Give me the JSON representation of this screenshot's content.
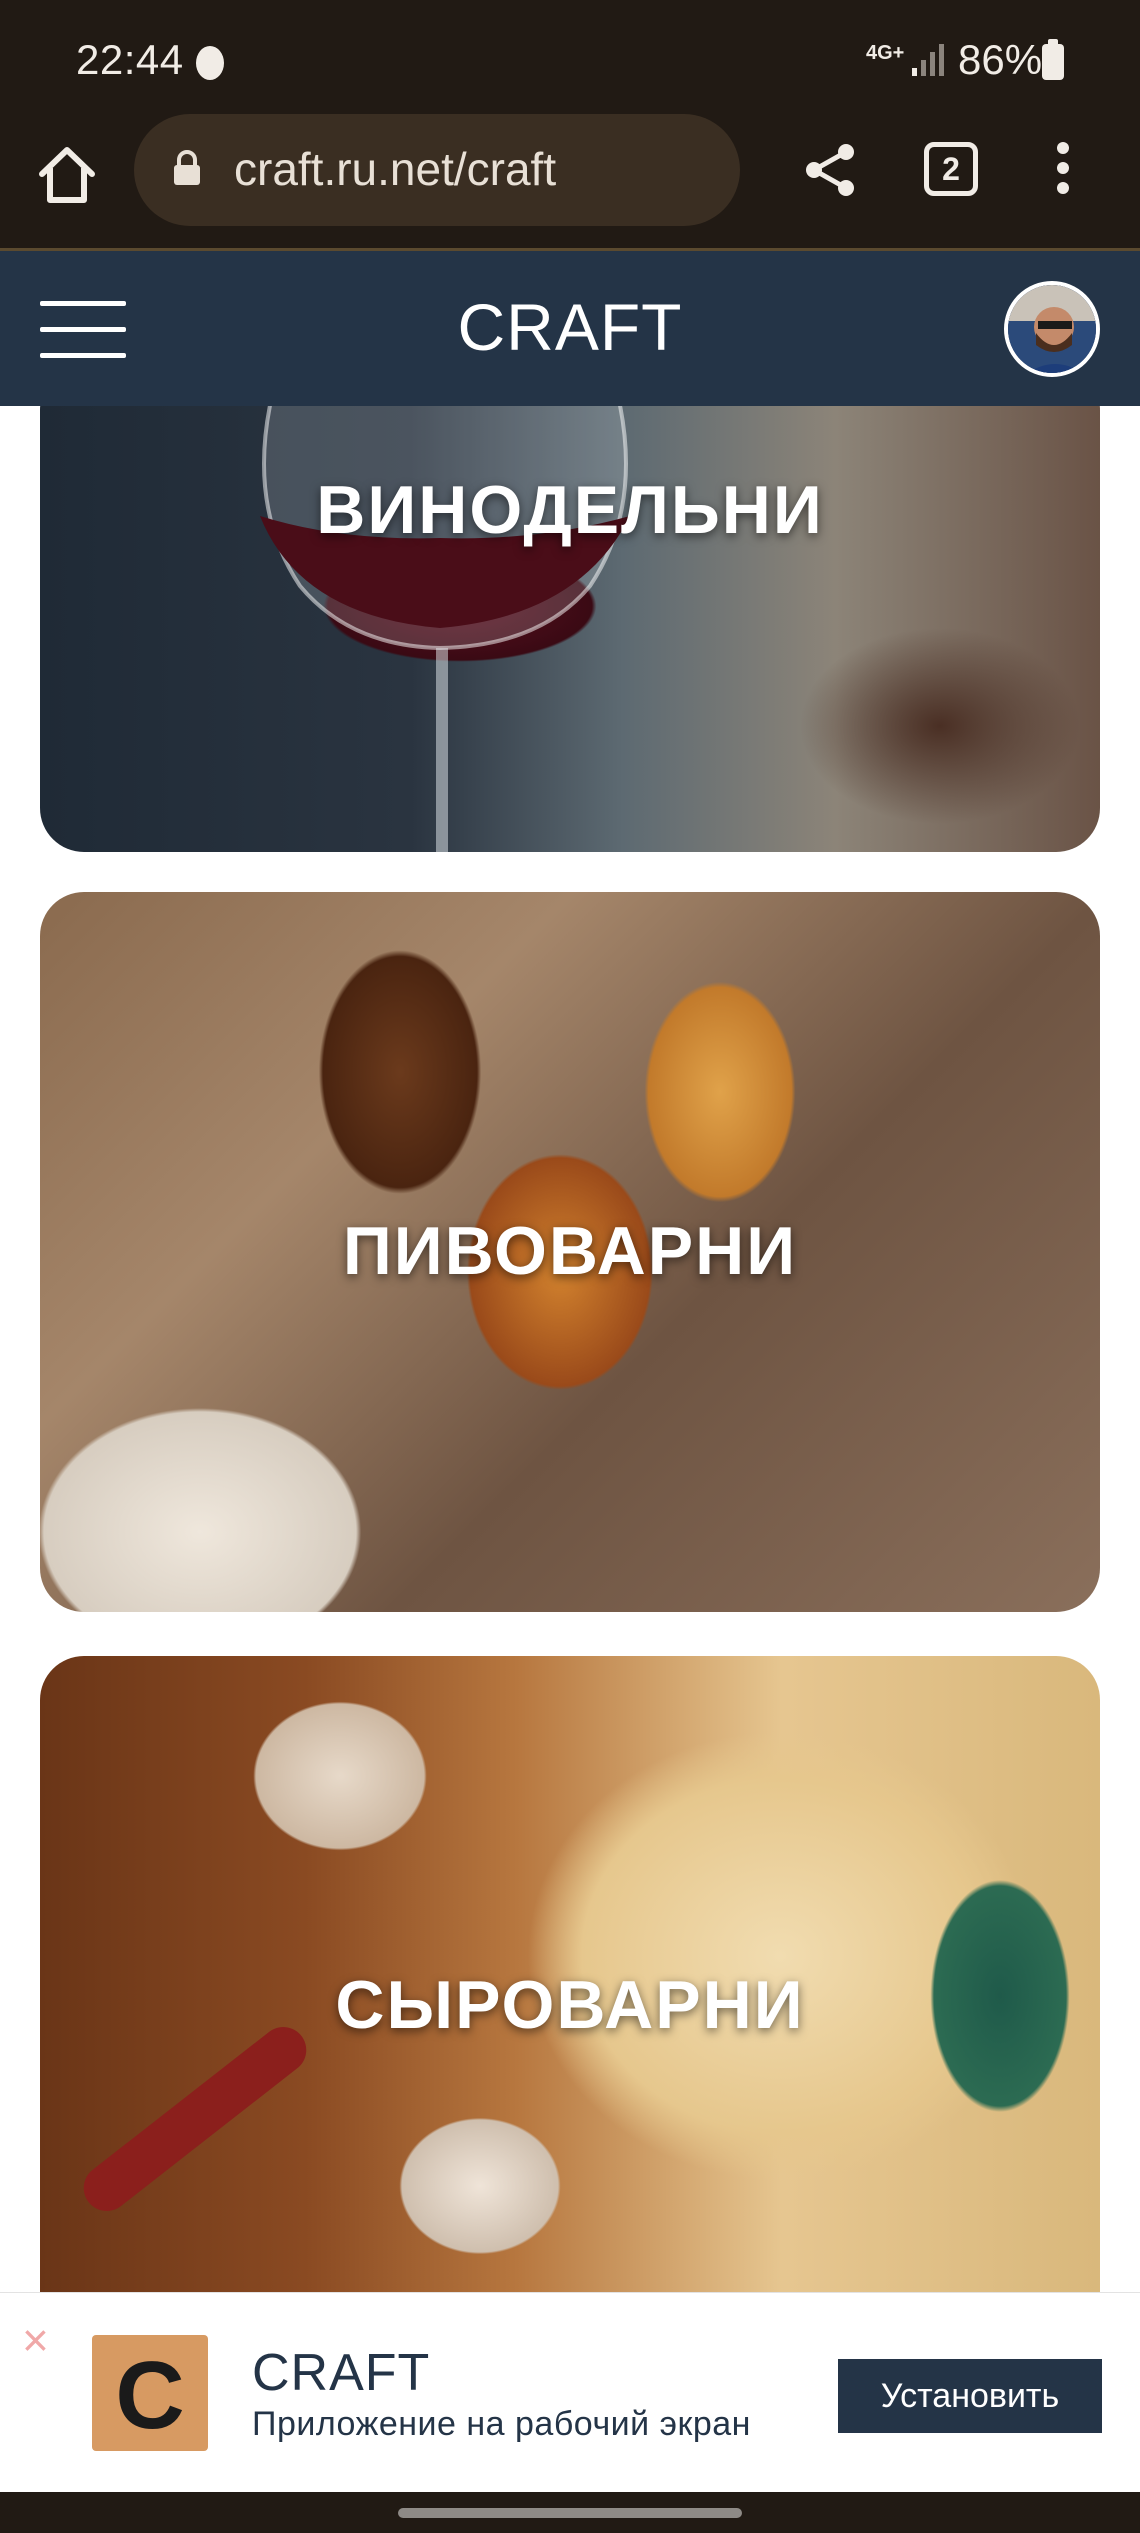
{
  "status_bar": {
    "time": "22:44",
    "network": "4G+",
    "battery_percent": "86%"
  },
  "browser": {
    "url": "craft.ru.net/craft",
    "tab_count": "2"
  },
  "header": {
    "title": "CRAFT"
  },
  "categories": [
    {
      "label": "ВИНОДЕЛЬНИ"
    },
    {
      "label": "ПИВОВАРНИ"
    },
    {
      "label": "СЫРОВАРНИ"
    }
  ],
  "install_banner": {
    "close_label": "×",
    "icon_letter": "C",
    "title": "CRAFT",
    "subtitle": "Приложение на рабочий экран",
    "button_label": "Установить"
  },
  "colors": {
    "header_bg": "#243447",
    "browser_bg": "#211a14",
    "accent": "#243447"
  }
}
